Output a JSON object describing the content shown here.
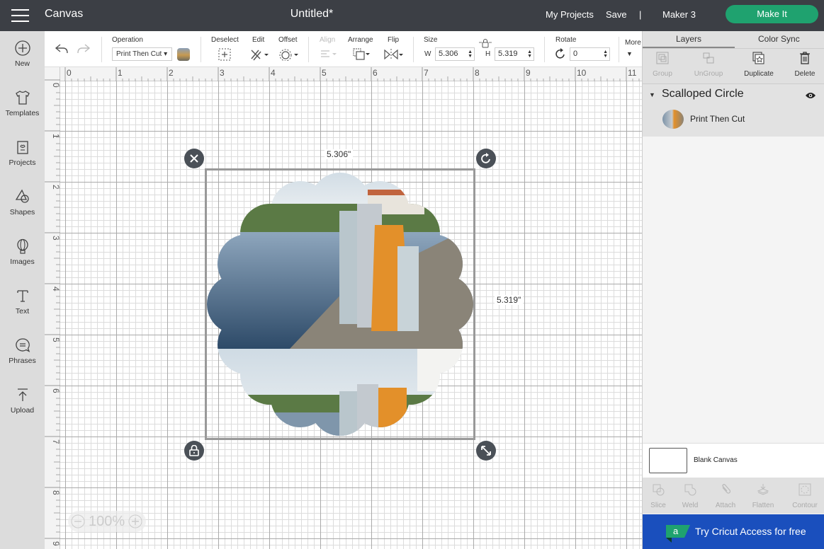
{
  "header": {
    "app_title": "Canvas",
    "doc_title": "Untitled*",
    "my_projects": "My Projects",
    "save": "Save",
    "separator": "|",
    "machine": "Maker 3",
    "make_it": "Make It"
  },
  "sidebar": {
    "items": [
      {
        "label": "New",
        "icon": "plus-circle-icon"
      },
      {
        "label": "Templates",
        "icon": "tshirt-icon"
      },
      {
        "label": "Projects",
        "icon": "projects-icon"
      },
      {
        "label": "Shapes",
        "icon": "shapes-icon"
      },
      {
        "label": "Images",
        "icon": "lightbulb-icon"
      },
      {
        "label": "Text",
        "icon": "text-icon"
      },
      {
        "label": "Phrases",
        "icon": "speech-bubble-icon"
      },
      {
        "label": "Upload",
        "icon": "upload-icon"
      }
    ]
  },
  "toolbar": {
    "operation_label": "Operation",
    "operation_value": "Print Then Cut",
    "deselect": "Deselect",
    "edit": "Edit",
    "offset": "Offset",
    "align": "Align",
    "arrange": "Arrange",
    "flip": "Flip",
    "size_label": "Size",
    "w_label": "W",
    "width_value": "5.306",
    "h_label": "H",
    "height_value": "5.319",
    "rotate_label": "Rotate",
    "rotate_value": "0",
    "more": "More"
  },
  "rulers": {
    "top": [
      "0",
      "1",
      "2",
      "3",
      "4",
      "5",
      "6",
      "7",
      "8",
      "9",
      "10",
      "11"
    ],
    "left": [
      "0",
      "1",
      "2",
      "3",
      "4",
      "5",
      "6",
      "7",
      "8",
      "9"
    ]
  },
  "canvas": {
    "width_dim": "5.306\"",
    "height_dim": "5.319\"",
    "zoom": "100%"
  },
  "right_panel": {
    "tabs": [
      "Layers",
      "Color Sync"
    ],
    "tools": [
      "Group",
      "UnGroup",
      "Duplicate",
      "Delete"
    ],
    "group_name": "Scalloped Circle",
    "layer_name": "Print Then Cut",
    "blank_canvas": "Blank Canvas",
    "bottom_tools": [
      "Slice",
      "Weld",
      "Attach",
      "Flatten",
      "Contour"
    ],
    "access_banner": "Try Cricut Access for free"
  },
  "colors": {
    "header_bg": "#3c3f45",
    "make_it_green": "#1fa26f",
    "access_blue": "#1a4fbd",
    "access_logo_green": "#1fa26f"
  }
}
